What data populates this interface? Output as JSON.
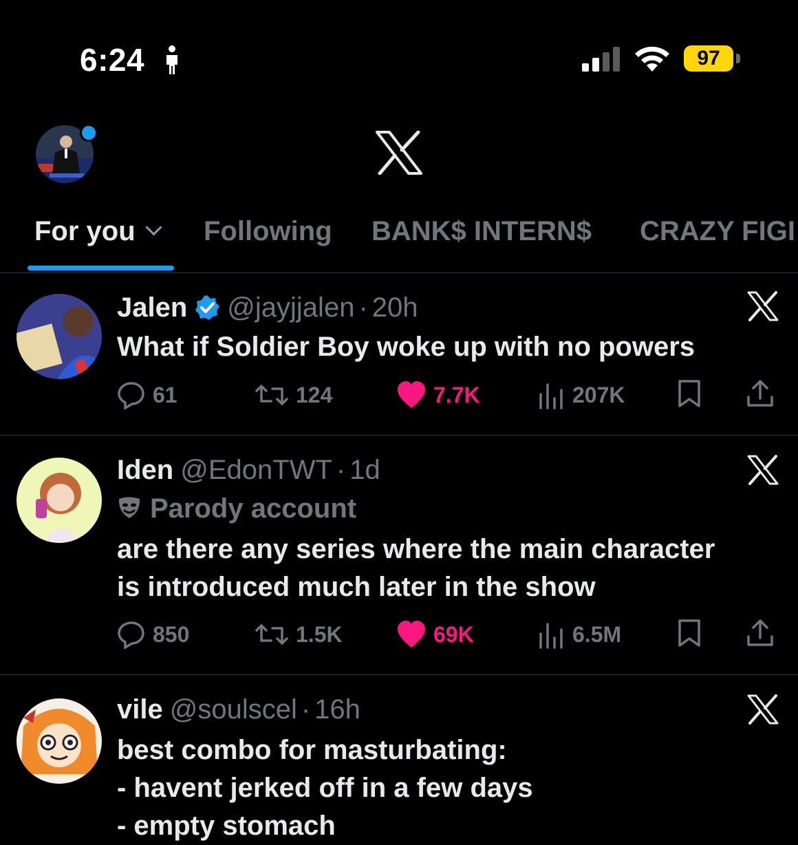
{
  "status_bar": {
    "time": "6:24",
    "battery": "97",
    "icons": [
      "person-standing-icon",
      "cellular-signal-icon",
      "wifi-icon"
    ]
  },
  "header": {
    "logo": "X",
    "profile_avatar_icon": "profile-avatar"
  },
  "tabs": [
    {
      "label": "For you",
      "active": true
    },
    {
      "label": "Following",
      "active": false
    },
    {
      "label": "BANK$ INTERN$",
      "active": false
    },
    {
      "label": "CRAZY FIGI",
      "active": false
    }
  ],
  "colors": {
    "accent": "#1d9bf0",
    "like": "#f91880",
    "muted": "#71767b",
    "battery": "#ffd60a"
  },
  "tweets": [
    {
      "name": "Jalen",
      "verified": true,
      "handle": "@jayjjalen",
      "sep": "·",
      "time": "20h",
      "body": [
        "What if Soldier Boy woke up with no powers"
      ],
      "replies": "61",
      "reposts": "124",
      "likes": "7.7K",
      "views": "207K"
    },
    {
      "name": "Iden",
      "verified": false,
      "handle": "@EdonTWT",
      "sep": "·",
      "time": "1d",
      "label": "Parody account",
      "body": [
        "are there any series where the main character",
        "is introduced much later in the show"
      ],
      "replies": "850",
      "reposts": "1.5K",
      "likes": "69K",
      "views": "6.5M"
    },
    {
      "name": "vile",
      "verified": false,
      "handle": "@soulscel",
      "sep": "·",
      "time": "16h",
      "body": [
        "best combo for masturbating:",
        "- havent jerked off in a few days",
        "- empty stomach"
      ]
    }
  ]
}
